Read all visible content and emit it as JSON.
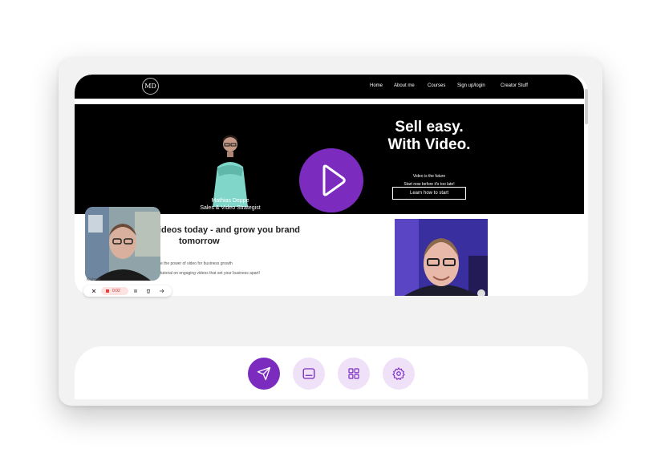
{
  "colors": {
    "accent": "#7b2cbf",
    "accent_soft": "#efe1f8",
    "site_header": "#000000"
  },
  "site": {
    "logo_text": "MD",
    "nav": [
      "Home",
      "About me",
      "Courses",
      "Sign up/login",
      "Creator Stuff"
    ],
    "hero": {
      "title_line1": "Sell easy.",
      "title_line2": "With Video.",
      "small_line1": "Video is the future",
      "small_line2": "Start now before it's too late!",
      "button": "Learn how to start",
      "person_name": "Mathias Deppe",
      "person_role": "Sales & Video Strategist"
    },
    "section": {
      "title_line1": "ideos today - and grow you brand",
      "title_line2": "tomorrow",
      "body_line1": "e the power of video for business growth",
      "body_line2": "tutorial on engaging videos that set your business apart!"
    }
  },
  "recorder": {
    "label": "Kishore",
    "timer": "0:02",
    "icons": [
      "close-icon",
      "stop-icon",
      "pause-icon",
      "trash-icon",
      "expand-icon"
    ]
  },
  "player": {
    "play_icon": "play-icon"
  },
  "toolbar": {
    "buttons": [
      {
        "name": "send-icon",
        "active": true
      },
      {
        "name": "captions-icon",
        "active": false
      },
      {
        "name": "grid-icon",
        "active": false
      },
      {
        "name": "gear-icon",
        "active": false
      }
    ]
  }
}
